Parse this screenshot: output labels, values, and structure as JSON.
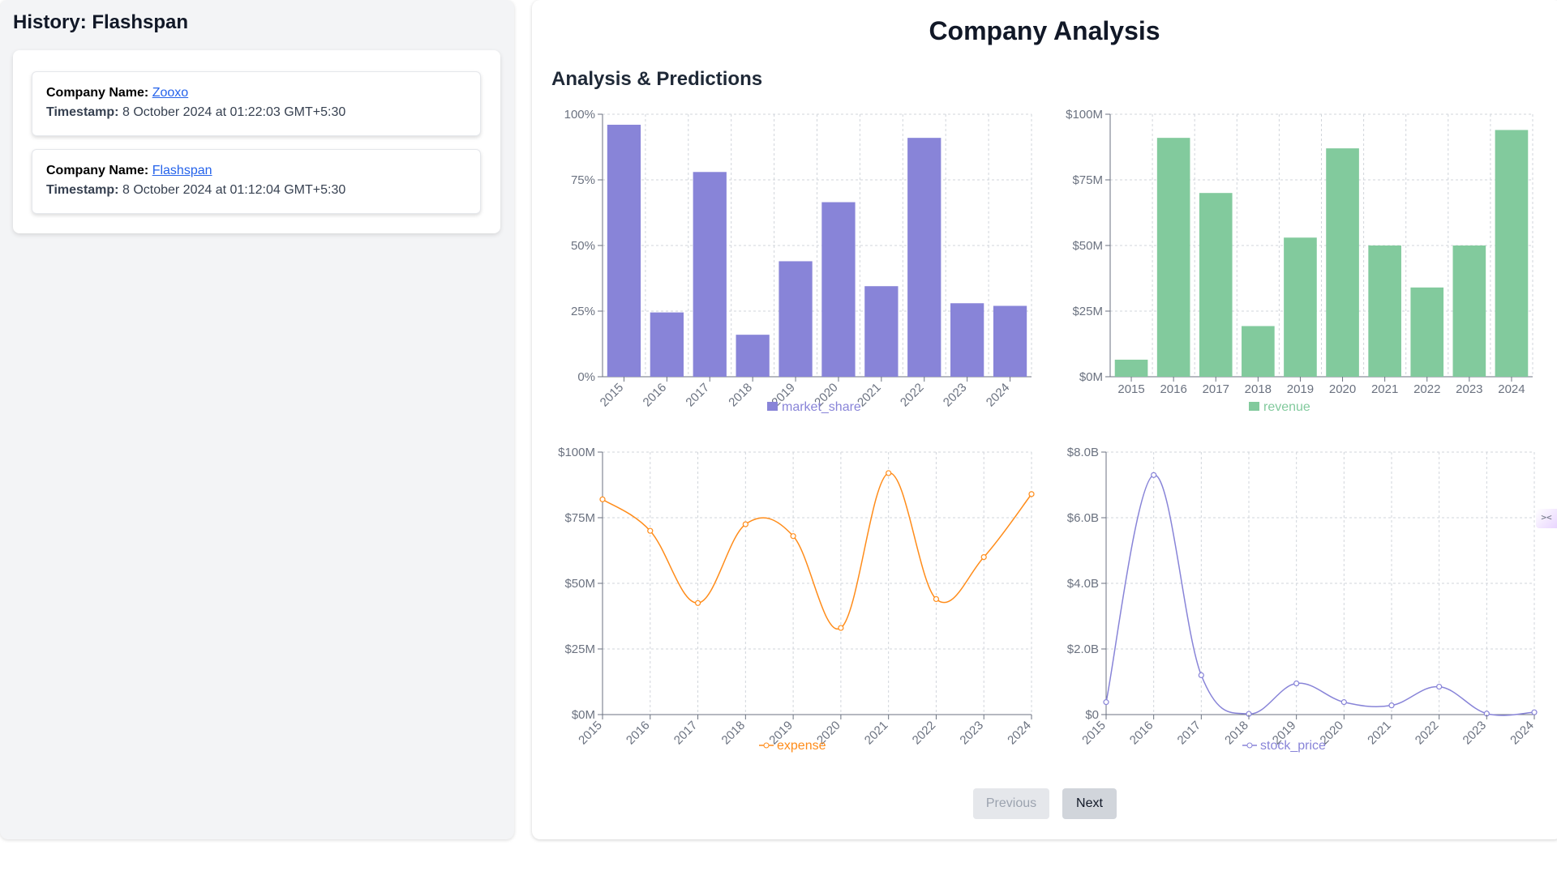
{
  "sidebar": {
    "title": "History: Flashspan",
    "company_label": "Company Name:",
    "timestamp_label": "Timestamp:",
    "entries": [
      {
        "company": "Zooxo",
        "timestamp": "8 October 2024 at 01:22:03 GMT+5:30"
      },
      {
        "company": "Flashspan",
        "timestamp": "8 October 2024 at 01:12:04 GMT+5:30"
      }
    ]
  },
  "main": {
    "title": "Company Analysis",
    "section_title": "Analysis & Predictions",
    "pagination": {
      "previous_label": "Previous",
      "next_label": "Next"
    },
    "side_toggle_icon": "collapse-icon"
  },
  "colors": {
    "market_share": "#8884d8",
    "revenue": "#82ca9d",
    "expense": "#ff8c1a",
    "stock_price": "#8884d8"
  },
  "chart_data": [
    {
      "type": "bar",
      "categories": [
        "2015",
        "2016",
        "2017",
        "2018",
        "2019",
        "2020",
        "2021",
        "2022",
        "2023",
        "2024"
      ],
      "series": [
        {
          "name": "market_share",
          "values": [
            0.96,
            0.245,
            0.78,
            0.16,
            0.44,
            0.665,
            0.345,
            0.91,
            0.28,
            0.27
          ]
        }
      ],
      "ylim": [
        0,
        1
      ],
      "yticks": [
        "0%",
        "25%",
        "50%",
        "75%",
        "100%"
      ],
      "grid": true,
      "legend": "bottom"
    },
    {
      "type": "bar",
      "categories": [
        "2015",
        "2016",
        "2017",
        "2018",
        "2019",
        "2020",
        "2021",
        "2022",
        "2023",
        "2024"
      ],
      "series": [
        {
          "name": "revenue",
          "values": [
            6.5,
            91,
            70,
            19.3,
            53,
            87,
            50,
            34,
            50,
            94
          ]
        }
      ],
      "ylim": [
        0,
        100
      ],
      "yticks": [
        "$0M",
        "$25M",
        "$50M",
        "$75M",
        "$100M"
      ],
      "grid": true,
      "legend": "bottom"
    },
    {
      "type": "line",
      "categories": [
        "2015",
        "2016",
        "2017",
        "2018",
        "2019",
        "2020",
        "2021",
        "2022",
        "2023",
        "2024"
      ],
      "series": [
        {
          "name": "expense",
          "values": [
            82,
            70,
            42.5,
            72.5,
            68,
            33,
            92,
            44,
            60,
            84
          ]
        }
      ],
      "ylim": [
        0,
        100
      ],
      "yticks": [
        "$0M",
        "$25M",
        "$50M",
        "$75M",
        "$100M"
      ],
      "grid": true,
      "legend": "bottom"
    },
    {
      "type": "line",
      "categories": [
        "2015",
        "2016",
        "2017",
        "2018",
        "2019",
        "2020",
        "2021",
        "2022",
        "2023",
        "2024"
      ],
      "series": [
        {
          "name": "stock_price",
          "values": [
            0.38,
            7.3,
            1.2,
            0.02,
            0.95,
            0.38,
            0.28,
            0.85,
            0.03,
            0.07
          ]
        }
      ],
      "ylim": [
        0,
        8
      ],
      "yticks": [
        "$0",
        "$2.0B",
        "$4.0B",
        "$6.0B",
        "$8.0B"
      ],
      "grid": true,
      "legend": "bottom"
    }
  ]
}
